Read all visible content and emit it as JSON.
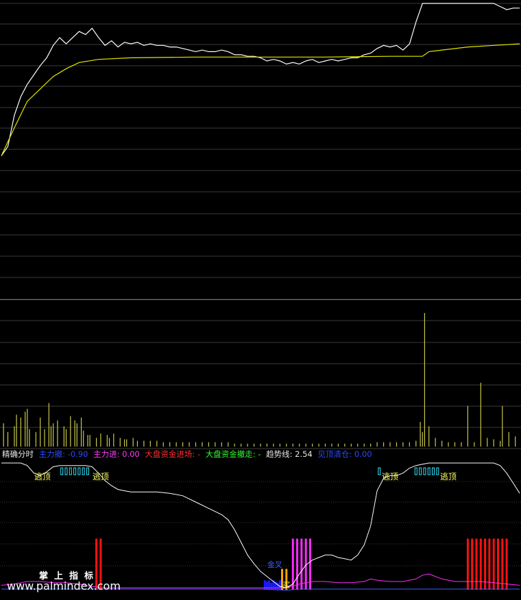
{
  "legend": {
    "title": "精确分时",
    "items": [
      {
        "label": "主力撤:",
        "value": "-0.90",
        "label_color": "#2a4bff",
        "value_color": "#2a4bff"
      },
      {
        "label": "主力进:",
        "value": "0.00",
        "label_color": "#ff3dff",
        "value_color": "#ff3dff"
      },
      {
        "label": "大盘资金进场:",
        "value": "-",
        "label_color": "#ff3030",
        "value_color": "#ff3030"
      },
      {
        "label": "大盘资金撤走:",
        "value": "-",
        "label_color": "#30ff30",
        "value_color": "#30ff30"
      },
      {
        "label": "趋势线:",
        "value": "2.54",
        "label_color": "#e6e6e6",
        "value_color": "#e6e6e6"
      },
      {
        "label": "见顶清仓:",
        "value": "0.00",
        "label_color": "#2a4bff",
        "value_color": "#2a4bff"
      }
    ]
  },
  "annotations": {
    "escape_top": "逃顶",
    "bottom_signal": "金叉",
    "buy": "买"
  },
  "watermark": {
    "cn": "掌上指标",
    "en": "www.palmindex.com"
  },
  "colors": {
    "price": "#ffffff",
    "avg": "#e6e600",
    "volume": "#c8c84a",
    "trend": "#ffffff",
    "grid": "#3a3a3a",
    "red_bar": "#ff1010",
    "magenta_bar": "#ff2bff",
    "blue_bar": "#1a1aff",
    "orange_bar": "#ffa500",
    "cyan": "#33e6ff",
    "annot": "#ffff66"
  },
  "chart_data": [
    {
      "type": "line",
      "panel": "price",
      "x_range": [
        0,
        240
      ],
      "y_range": [
        0,
        100
      ],
      "series": [
        {
          "key": "price",
          "points": [
            [
              0,
              2
            ],
            [
              3,
              8
            ],
            [
              6,
              28
            ],
            [
              9,
              40
            ],
            [
              12,
              48
            ],
            [
              15,
              54
            ],
            [
              18,
              60
            ],
            [
              21,
              65
            ],
            [
              24,
              73
            ],
            [
              27,
              78
            ],
            [
              30,
              74
            ],
            [
              33,
              78
            ],
            [
              36,
              82
            ],
            [
              39,
              80
            ],
            [
              42,
              84
            ],
            [
              45,
              78
            ],
            [
              48,
              73
            ],
            [
              51,
              76
            ],
            [
              54,
              72
            ],
            [
              57,
              75
            ],
            [
              60,
              74
            ],
            [
              63,
              75
            ],
            [
              66,
              73
            ],
            [
              69,
              74
            ],
            [
              72,
              73
            ],
            [
              75,
              73
            ],
            [
              78,
              72
            ],
            [
              81,
              72
            ],
            [
              84,
              71
            ],
            [
              87,
              70
            ],
            [
              90,
              69
            ],
            [
              93,
              70
            ],
            [
              96,
              69
            ],
            [
              99,
              69
            ],
            [
              102,
              70
            ],
            [
              105,
              69
            ],
            [
              108,
              67
            ],
            [
              111,
              67
            ],
            [
              114,
              66
            ],
            [
              117,
              66
            ],
            [
              120,
              65
            ],
            [
              123,
              63
            ],
            [
              126,
              64
            ],
            [
              129,
              63
            ],
            [
              132,
              61
            ],
            [
              135,
              62
            ],
            [
              138,
              61
            ],
            [
              141,
              63
            ],
            [
              144,
              64
            ],
            [
              147,
              62
            ],
            [
              150,
              63
            ],
            [
              153,
              64
            ],
            [
              156,
              63
            ],
            [
              159,
              64
            ],
            [
              162,
              65
            ],
            [
              165,
              65
            ],
            [
              168,
              67
            ],
            [
              171,
              68
            ],
            [
              174,
              71
            ],
            [
              177,
              73
            ],
            [
              180,
              72
            ],
            [
              183,
              73
            ],
            [
              186,
              70
            ],
            [
              189,
              74
            ],
            [
              192,
              88
            ],
            [
              195,
              100
            ],
            [
              198,
              100
            ],
            [
              201,
              100
            ],
            [
              204,
              100
            ],
            [
              207,
              100
            ],
            [
              210,
              100
            ],
            [
              213,
              100
            ],
            [
              216,
              100
            ],
            [
              219,
              100
            ],
            [
              222,
              100
            ],
            [
              225,
              100
            ],
            [
              228,
              100
            ],
            [
              231,
              98
            ],
            [
              234,
              96
            ],
            [
              237,
              97
            ],
            [
              240,
              97
            ]
          ]
        },
        {
          "key": "avg",
          "points": [
            [
              0,
              2
            ],
            [
              6,
              20
            ],
            [
              12,
              37
            ],
            [
              18,
              45
            ],
            [
              24,
              53
            ],
            [
              30,
              58
            ],
            [
              36,
              62
            ],
            [
              45,
              64
            ],
            [
              60,
              65
            ],
            [
              90,
              65.5
            ],
            [
              120,
              65.5
            ],
            [
              150,
              65.5
            ],
            [
              180,
              66
            ],
            [
              195,
              66
            ],
            [
              198,
              69
            ],
            [
              204,
              70
            ],
            [
              216,
              72
            ],
            [
              228,
              73
            ],
            [
              240,
              74
            ]
          ]
        }
      ]
    },
    {
      "type": "bar",
      "panel": "volume",
      "x_range": [
        0,
        240
      ],
      "y_range": [
        0,
        100
      ],
      "x": [
        1,
        3,
        6,
        7,
        9,
        11,
        12,
        13,
        16,
        18,
        20,
        22,
        23,
        24,
        26,
        29,
        30,
        32,
        34,
        35,
        37,
        38,
        40,
        41,
        44,
        46,
        49,
        50,
        52,
        55,
        57,
        58,
        61,
        63,
        66,
        69,
        72,
        75,
        78,
        81,
        84,
        87,
        90,
        93,
        96,
        99,
        102,
        105,
        108,
        111,
        114,
        117,
        120,
        123,
        126,
        129,
        132,
        135,
        138,
        141,
        144,
        147,
        150,
        153,
        156,
        159,
        162,
        165,
        168,
        171,
        174,
        177,
        180,
        183,
        186,
        189,
        192,
        194,
        195,
        196,
        198,
        201,
        204,
        207,
        210,
        213,
        216,
        219,
        222,
        225,
        228,
        231,
        232,
        235,
        238
      ],
      "values": [
        16,
        10,
        14,
        22,
        20,
        24,
        26,
        12,
        10,
        20,
        12,
        30,
        14,
        16,
        18,
        14,
        12,
        21,
        18,
        16,
        20,
        11,
        8,
        8,
        6,
        9,
        8,
        6,
        9,
        6,
        5,
        5,
        6,
        4,
        4,
        4,
        4,
        3,
        3,
        3,
        3,
        3,
        3,
        3,
        3,
        3,
        3,
        3,
        2,
        2,
        2,
        2,
        2,
        2,
        2,
        2,
        2,
        2,
        2,
        2,
        2,
        2,
        2,
        2,
        2,
        2,
        2,
        2,
        2,
        2,
        3,
        3,
        3,
        3,
        3,
        3,
        4,
        17,
        10,
        92,
        14,
        6,
        4,
        3,
        3,
        3,
        28,
        3,
        44,
        6,
        5,
        4,
        28,
        10,
        7
      ]
    },
    {
      "type": "line",
      "panel": "indicator",
      "x_range": [
        0,
        240
      ],
      "y_range": [
        0,
        100
      ],
      "trend_line": {
        "key": "trend",
        "points": [
          [
            0,
            100
          ],
          [
            9,
            100
          ],
          [
            12,
            98
          ],
          [
            15,
            92
          ],
          [
            18,
            90
          ],
          [
            21,
            93
          ],
          [
            24,
            97
          ],
          [
            27,
            98
          ],
          [
            30,
            98
          ],
          [
            33,
            98
          ],
          [
            36,
            98
          ],
          [
            39,
            98
          ],
          [
            42,
            97
          ],
          [
            45,
            92
          ],
          [
            48,
            86
          ],
          [
            51,
            82
          ],
          [
            54,
            79
          ],
          [
            57,
            78
          ],
          [
            60,
            77
          ],
          [
            66,
            77
          ],
          [
            72,
            77
          ],
          [
            78,
            76
          ],
          [
            84,
            74
          ],
          [
            90,
            69
          ],
          [
            96,
            64
          ],
          [
            102,
            59
          ],
          [
            105,
            55
          ],
          [
            108,
            47
          ],
          [
            111,
            37
          ],
          [
            114,
            27
          ],
          [
            117,
            20
          ],
          [
            120,
            14
          ],
          [
            123,
            10
          ],
          [
            126,
            6
          ],
          [
            129,
            2
          ],
          [
            132,
            1
          ],
          [
            135,
            4
          ],
          [
            138,
            12
          ],
          [
            141,
            19
          ],
          [
            144,
            23
          ],
          [
            147,
            25
          ],
          [
            150,
            27
          ],
          [
            153,
            27
          ],
          [
            156,
            25
          ],
          [
            159,
            24
          ],
          [
            162,
            23
          ],
          [
            165,
            27
          ],
          [
            168,
            35
          ],
          [
            171,
            50
          ],
          [
            174,
            78
          ],
          [
            177,
            88
          ],
          [
            180,
            90
          ],
          [
            183,
            90
          ],
          [
            186,
            92
          ],
          [
            189,
            96
          ],
          [
            192,
            98
          ],
          [
            195,
            99
          ],
          [
            198,
            100
          ],
          [
            204,
            100
          ],
          [
            210,
            100
          ],
          [
            216,
            100
          ],
          [
            222,
            100
          ],
          [
            228,
            100
          ],
          [
            231,
            98
          ],
          [
            234,
            92
          ],
          [
            237,
            84
          ],
          [
            240,
            76
          ]
        ]
      },
      "magenta_line": {
        "key": "magenta",
        "points": [
          [
            0,
            3
          ],
          [
            6,
            4
          ],
          [
            12,
            6
          ],
          [
            18,
            6
          ],
          [
            24,
            5
          ],
          [
            30,
            5
          ],
          [
            36,
            4
          ],
          [
            42,
            2
          ],
          [
            48,
            1
          ],
          [
            60,
            1
          ],
          [
            90,
            1
          ],
          [
            120,
            1
          ],
          [
            132,
            1
          ],
          [
            138,
            4
          ],
          [
            144,
            6
          ],
          [
            150,
            6
          ],
          [
            156,
            5
          ],
          [
            162,
            5
          ],
          [
            168,
            6
          ],
          [
            171,
            8
          ],
          [
            174,
            7
          ],
          [
            180,
            6
          ],
          [
            186,
            6
          ],
          [
            192,
            8
          ],
          [
            195,
            11
          ],
          [
            198,
            12
          ],
          [
            201,
            10
          ],
          [
            204,
            8
          ],
          [
            210,
            6
          ],
          [
            216,
            6
          ],
          [
            222,
            6
          ],
          [
            228,
            5
          ],
          [
            234,
            4
          ],
          [
            240,
            3
          ]
        ]
      },
      "blue_line": {
        "key": "blue",
        "points": [
          [
            0,
            0
          ],
          [
            60,
            0
          ],
          [
            120,
            0
          ],
          [
            132,
            -1
          ],
          [
            138,
            0
          ],
          [
            180,
            0
          ],
          [
            240,
            0
          ]
        ]
      },
      "red_bars": {
        "x": [
          44,
          46,
          216,
          218,
          220,
          222,
          224,
          226,
          228,
          230,
          232,
          234
        ],
        "values": [
          40,
          40,
          40,
          40,
          40,
          40,
          40,
          40,
          40,
          40,
          40,
          40
        ]
      },
      "magenta_bars": {
        "x": [
          135,
          137,
          139,
          141,
          143
        ],
        "values": [
          40,
          40,
          40,
          40,
          40
        ]
      },
      "blue_bars": {
        "x": [
          122,
          123,
          124,
          125,
          126,
          127,
          128,
          129
        ],
        "values": [
          7,
          6,
          7,
          5,
          7,
          6,
          5,
          7
        ]
      },
      "orange_bars": {
        "x": [
          130,
          132
        ],
        "values": [
          16,
          16
        ]
      },
      "cyan_marks": {
        "x": [
          28,
          30,
          32,
          34,
          36,
          38,
          40,
          175,
          192,
          194,
          196,
          198,
          200,
          202
        ],
        "values": [
          94,
          94,
          94,
          94,
          94,
          94,
          94,
          94,
          94,
          94,
          94,
          94,
          94,
          94
        ]
      },
      "escape_labels_x": [
        19,
        46,
        180,
        207
      ],
      "bottom_signal_x": 126,
      "buy_x": 132
    }
  ]
}
